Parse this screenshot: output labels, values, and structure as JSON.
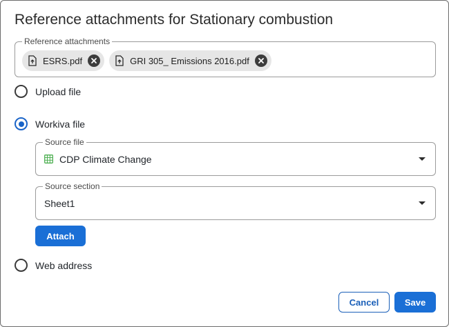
{
  "dialog": {
    "title": "Reference attachments for Stationary combustion"
  },
  "attachments": {
    "label": "Reference attachments",
    "chips": [
      {
        "name": "ESRS.pdf",
        "icon": "file-upload-icon"
      },
      {
        "name": "GRI 305_ Emissions 2016.pdf",
        "icon": "file-upload-icon"
      }
    ]
  },
  "options": {
    "upload": {
      "label": "Upload file",
      "checked": false
    },
    "workiva": {
      "label": "Workiva file",
      "checked": true
    },
    "web": {
      "label": "Web address",
      "checked": false
    }
  },
  "source_file": {
    "label": "Source file",
    "value": "CDP Climate Change",
    "icon": "spreadsheet-icon"
  },
  "source_section": {
    "label": "Source section",
    "value": "Sheet1"
  },
  "buttons": {
    "attach": "Attach",
    "cancel": "Cancel",
    "save": "Save"
  },
  "colors": {
    "accent": "#1a6fd6",
    "spreadsheet_icon": "#4caf50"
  }
}
